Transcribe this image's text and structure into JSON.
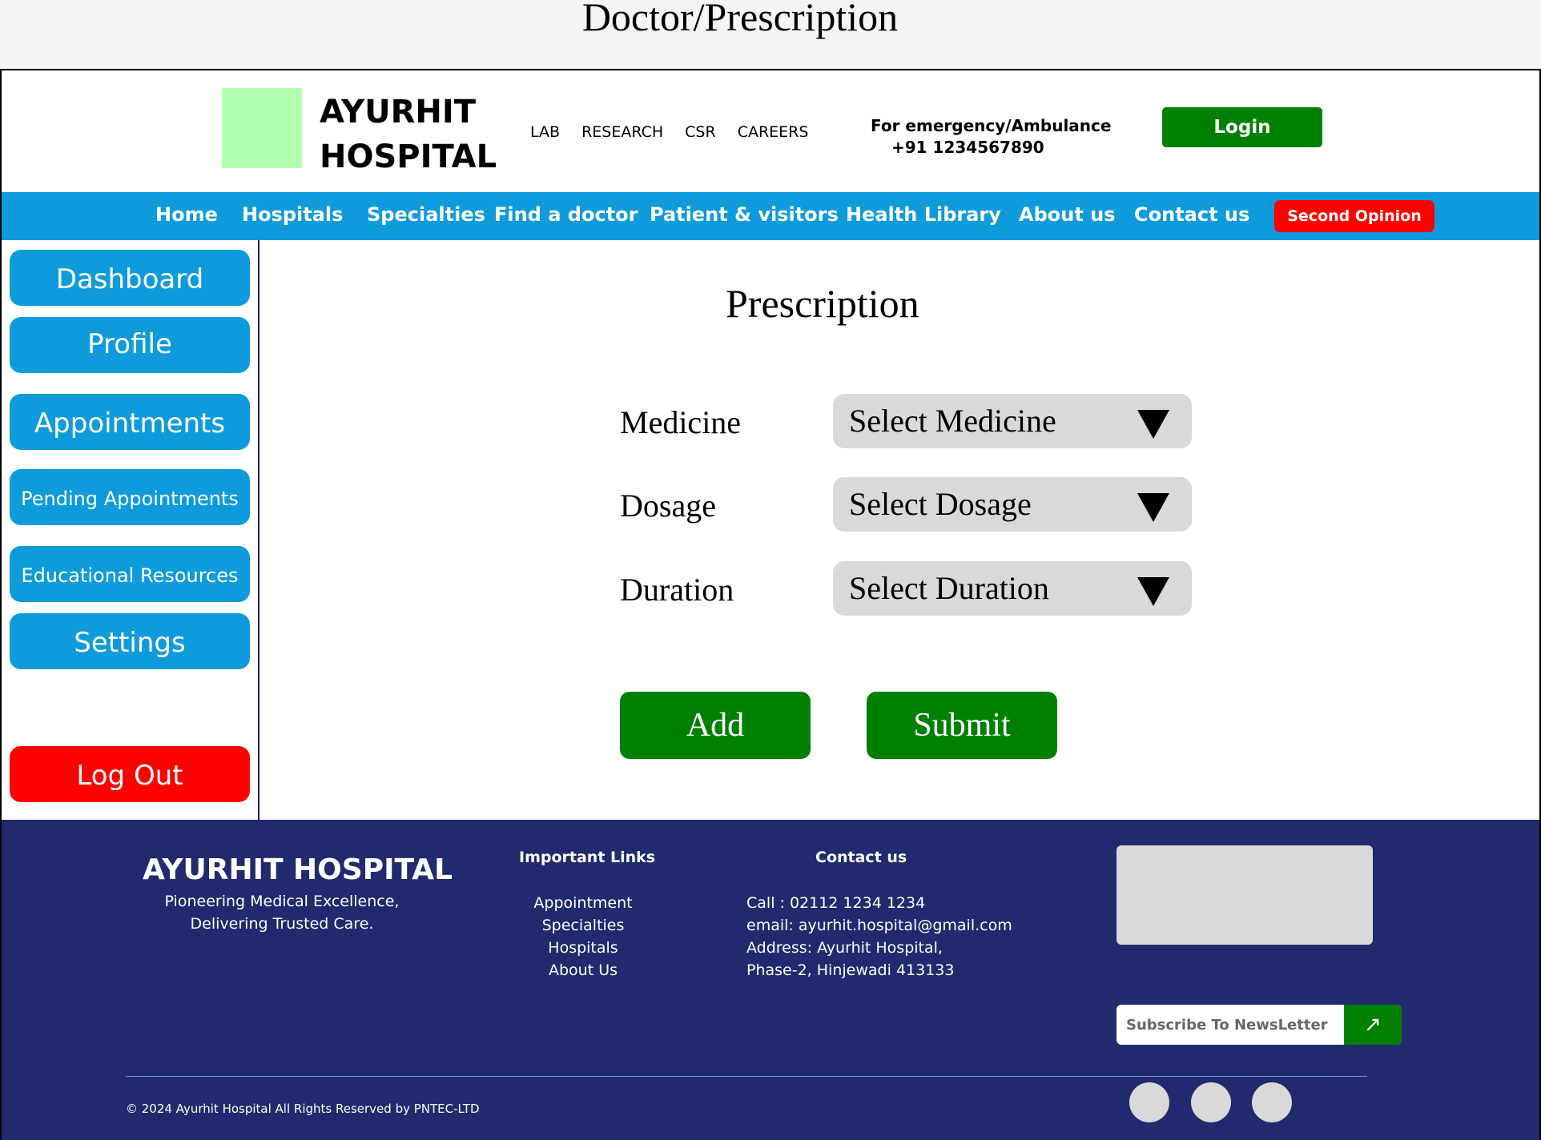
{
  "page_title": "Doctor/Prescription",
  "header": {
    "logo_line1": "AYURHIT",
    "logo_line2": "HOSPITAL",
    "top_links": [
      "LAB",
      "RESEARCH",
      "CSR",
      "CAREERS"
    ],
    "emergency_label": "For emergency/Ambulance",
    "emergency_phone": "+91 1234567890",
    "login_label": "Login"
  },
  "nav": {
    "items": [
      "Home",
      "Hospitals",
      "Specialties",
      "Find a doctor",
      "Patient & visitors",
      "Health Library",
      "About us",
      "Contact us"
    ],
    "second_opinion": "Second Opinion"
  },
  "sidebar": {
    "items": [
      "Dashboard",
      "Profile",
      "Appointments",
      "Pending Appointments",
      "Educational Resources",
      "Settings"
    ],
    "logout": "Log Out"
  },
  "main": {
    "title": "Prescription",
    "fields": [
      {
        "label": "Medicine",
        "value": "Select Medicine"
      },
      {
        "label": "Dosage",
        "value": "Select Dosage"
      },
      {
        "label": "Duration",
        "value": "Select Duration"
      }
    ],
    "add_label": "Add",
    "submit_label": "Submit"
  },
  "footer": {
    "name": "AYURHIT HOSPITAL",
    "tagline1": "Pioneering Medical Excellence,",
    "tagline2": "Delivering Trusted Care.",
    "links_heading": "Important Links",
    "links": [
      "Appointment",
      "Specialties",
      "Hospitals",
      "About Us"
    ],
    "contact_heading": "Contact us",
    "contact": [
      "Call : 02112 1234 1234",
      "email: ayurhit.hospital@gmail.com",
      "Address: Ayurhit Hospital,",
      "Phase-2, Hinjewadi 413133"
    ],
    "newsletter_placeholder": "Subscribe To NewsLetter",
    "newsletter_icon": "arrow-up-right-icon",
    "copyright": "© 2024 Ayurhit Hospital All Rights Reserved by PNTEC-LTD"
  },
  "colors": {
    "nav_blue": "#0e9bdc",
    "green": "#008000",
    "red": "#ff0000",
    "footer_navy": "#212a6e"
  }
}
